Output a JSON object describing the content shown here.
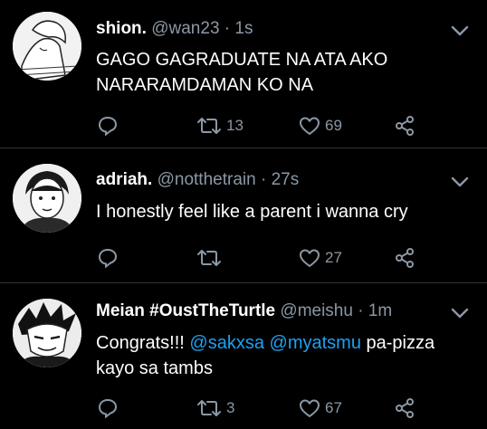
{
  "tweets": [
    {
      "name": "shion.",
      "handle": "@wan23",
      "separator": "·",
      "time": "1s",
      "text_lines": [
        "GAGO GAGRADUATE NA ATA AKO",
        "NARARAMDAMAN KO NA"
      ],
      "retweets": "13",
      "likes": "69"
    },
    {
      "name": "adriah.",
      "handle": "@notthetrain",
      "separator": "·",
      "time": "27s",
      "text_lines": [
        "I honestly feel like a parent i wanna cry"
      ],
      "retweets": "",
      "likes": "27"
    },
    {
      "name": "Meian #OustTheTurtle",
      "handle": "@meishu",
      "separator": "·",
      "time": "1m",
      "text_parts": {
        "prefix": "Congrats!!! ",
        "mention1": "@sakxsa",
        "space": " ",
        "mention2": "@myatsmu",
        "suffix": " pa-pizza"
      },
      "text_line2": "kayo sa tambs",
      "retweets": "3",
      "likes": "67"
    }
  ],
  "colors": {
    "background": "#000000",
    "text": "#ffffff",
    "secondary": "#8b98a5",
    "mention": "#1da1f2",
    "divider": "#2f3336"
  },
  "icons": [
    "reply-icon",
    "retweet-icon",
    "like-icon",
    "share-icon",
    "chevron-down-icon"
  ]
}
